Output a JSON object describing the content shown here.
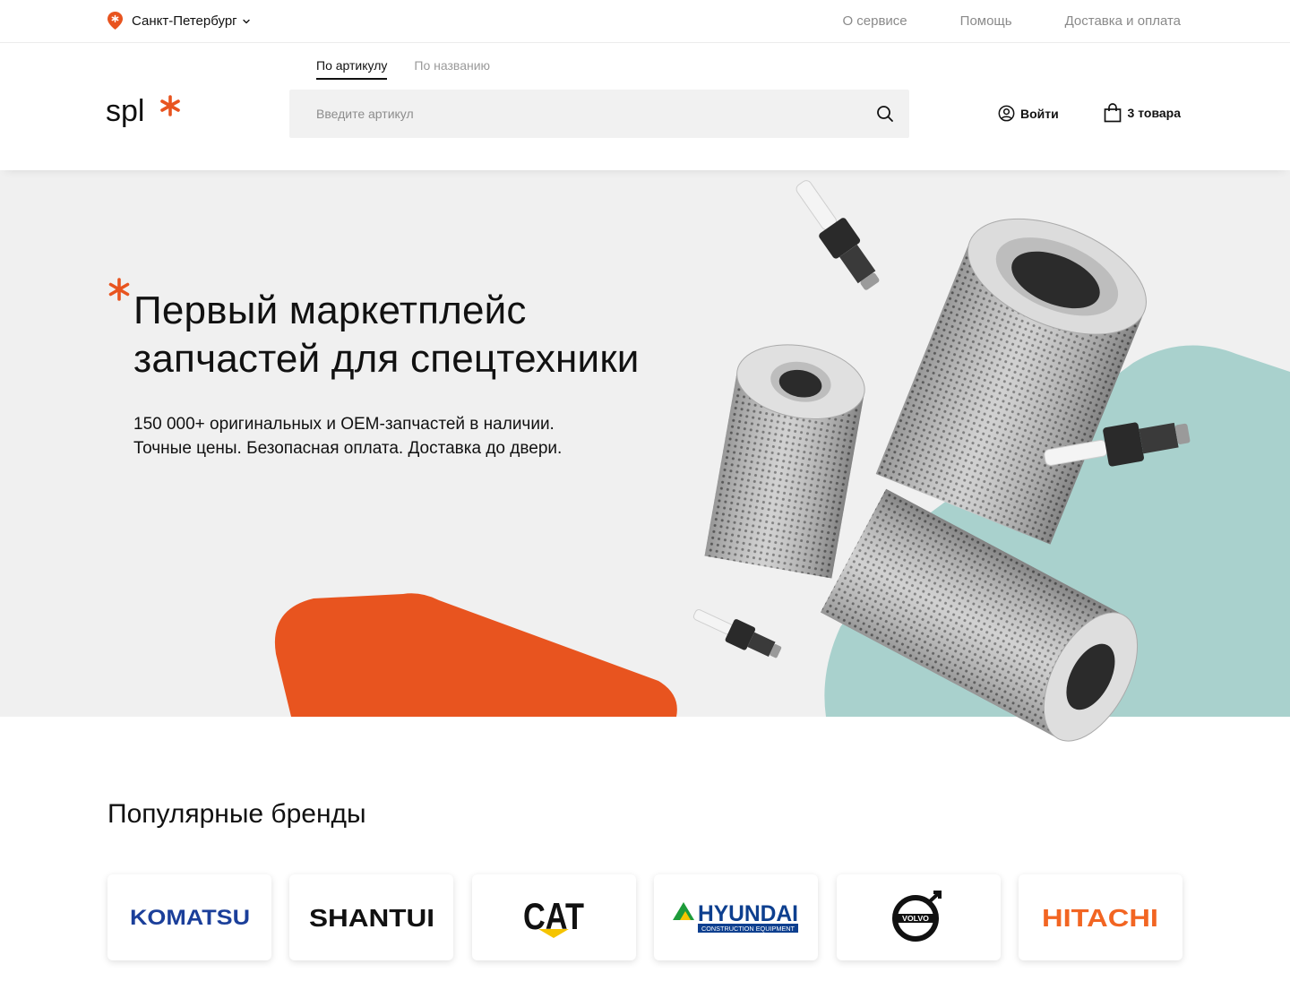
{
  "topbar": {
    "city": "Санкт-Петербург",
    "links": [
      "О сервисе",
      "Помощь",
      "Доставка и оплата"
    ]
  },
  "header": {
    "logo_text": "spl",
    "tabs": [
      "По артикулу",
      "По названию"
    ],
    "search_placeholder": "Введите артикул",
    "login_label": "Войти",
    "cart_label": "3 товара"
  },
  "hero": {
    "title_line1": "Первый маркетплейс",
    "title_line2": "запчастей для спецтехники",
    "subtitle_line1": "150 000+ оригинальных и OEM-запчастей в наличии.",
    "subtitle_line2": "Точные цены. Безопасная оплата. Доставка до двери."
  },
  "brands": {
    "title": "Популярные бренды",
    "items": [
      {
        "name": "KOMATSU",
        "color": "#1b3f9a"
      },
      {
        "name": "SHANTUI",
        "color": "#111111"
      },
      {
        "name": "CAT",
        "color": "#111111"
      },
      {
        "name": "HYUNDAI",
        "color": "#0d3f8f",
        "sub": "CONSTRUCTION EQUIPMENT"
      },
      {
        "name": "VOLVO",
        "color": "#111111"
      },
      {
        "name": "HITACHI",
        "color": "#f26522"
      }
    ]
  },
  "colors": {
    "accent": "#e8541f",
    "teal": "#a9d1cd",
    "hero_bg": "#f0f0f0"
  }
}
